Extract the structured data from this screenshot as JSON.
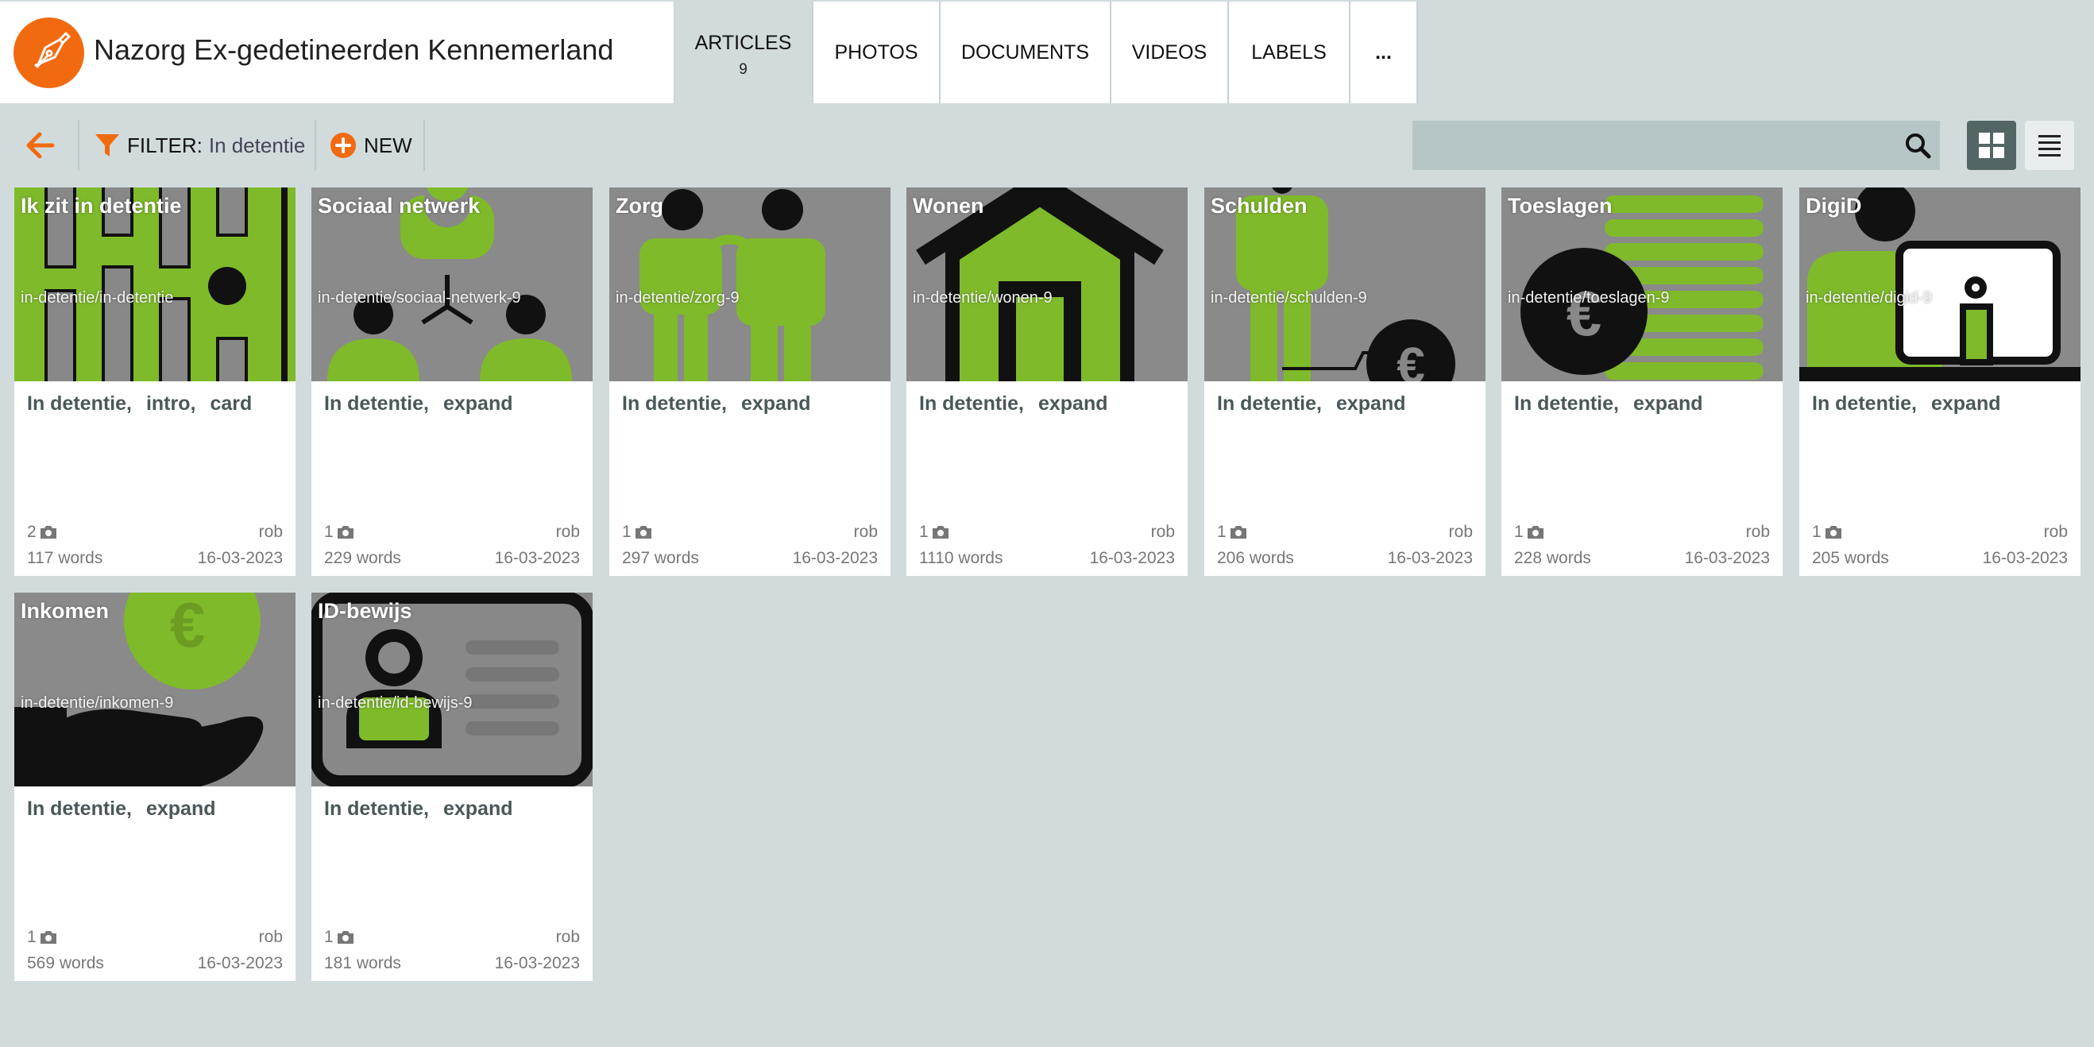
{
  "app": {
    "title": "Nazorg Ex-gedetineerden Kennemerland",
    "accent": "#f26a10",
    "label_green": "#7fba2a"
  },
  "tabs": [
    {
      "label": "ARTICLES",
      "count": "9",
      "active": true
    },
    {
      "label": "PHOTOS"
    },
    {
      "label": "DOCUMENTS"
    },
    {
      "label": "VIDEOS"
    },
    {
      "label": "LABELS"
    },
    {
      "label": "..."
    }
  ],
  "toolbar": {
    "back_icon": "arrow-left-icon",
    "filter_label": "FILTER:",
    "filter_value": "In detentie",
    "new_label": "NEW",
    "search_placeholder": "",
    "search_icon": "search-icon",
    "view_modes": [
      "grid",
      "list"
    ],
    "active_view": "grid"
  },
  "articles": [
    {
      "title": "Ik zit in detentie",
      "path": "in-detentie/in-detentie",
      "labels": [
        "In detentie,",
        "intro,",
        "card"
      ],
      "photos": "2",
      "author": "rob",
      "words": "117 words",
      "date": "16-03-2023"
    },
    {
      "title": "Sociaal netwerk",
      "path": "in-detentie/sociaal-netwerk-9",
      "labels": [
        "In detentie,",
        "expand"
      ],
      "photos": "1",
      "author": "rob",
      "words": "229 words",
      "date": "16-03-2023"
    },
    {
      "title": "Zorg",
      "path": "in-detentie/zorg-9",
      "labels": [
        "In detentie,",
        "expand"
      ],
      "photos": "1",
      "author": "rob",
      "words": "297 words",
      "date": "16-03-2023"
    },
    {
      "title": "Wonen",
      "path": "in-detentie/wonen-9",
      "labels": [
        "In detentie,",
        "expand"
      ],
      "photos": "1",
      "author": "rob",
      "words": "1110 words",
      "date": "16-03-2023"
    },
    {
      "title": "Schulden",
      "path": "in-detentie/schulden-9",
      "labels": [
        "In detentie,",
        "expand"
      ],
      "photos": "1",
      "author": "rob",
      "words": "206 words",
      "date": "16-03-2023"
    },
    {
      "title": "Toeslagen",
      "path": "in-detentie/toeslagen-9",
      "labels": [
        "In detentie,",
        "expand"
      ],
      "photos": "1",
      "author": "rob",
      "words": "228 words",
      "date": "16-03-2023"
    },
    {
      "title": "DigiD",
      "path": "in-detentie/digid-9",
      "labels": [
        "In detentie,",
        "expand"
      ],
      "photos": "1",
      "author": "rob",
      "words": "205 words",
      "date": "16-03-2023"
    },
    {
      "title": "Inkomen",
      "path": "in-detentie/inkomen-9",
      "labels": [
        "In detentie,",
        "expand"
      ],
      "photos": "1",
      "author": "rob",
      "words": "569 words",
      "date": "16-03-2023"
    },
    {
      "title": "ID-bewijs",
      "path": "in-detentie/id-bewijs-9",
      "labels": [
        "In detentie,",
        "expand"
      ],
      "photos": "1",
      "author": "rob",
      "words": "181 words",
      "date": "16-03-2023"
    }
  ]
}
